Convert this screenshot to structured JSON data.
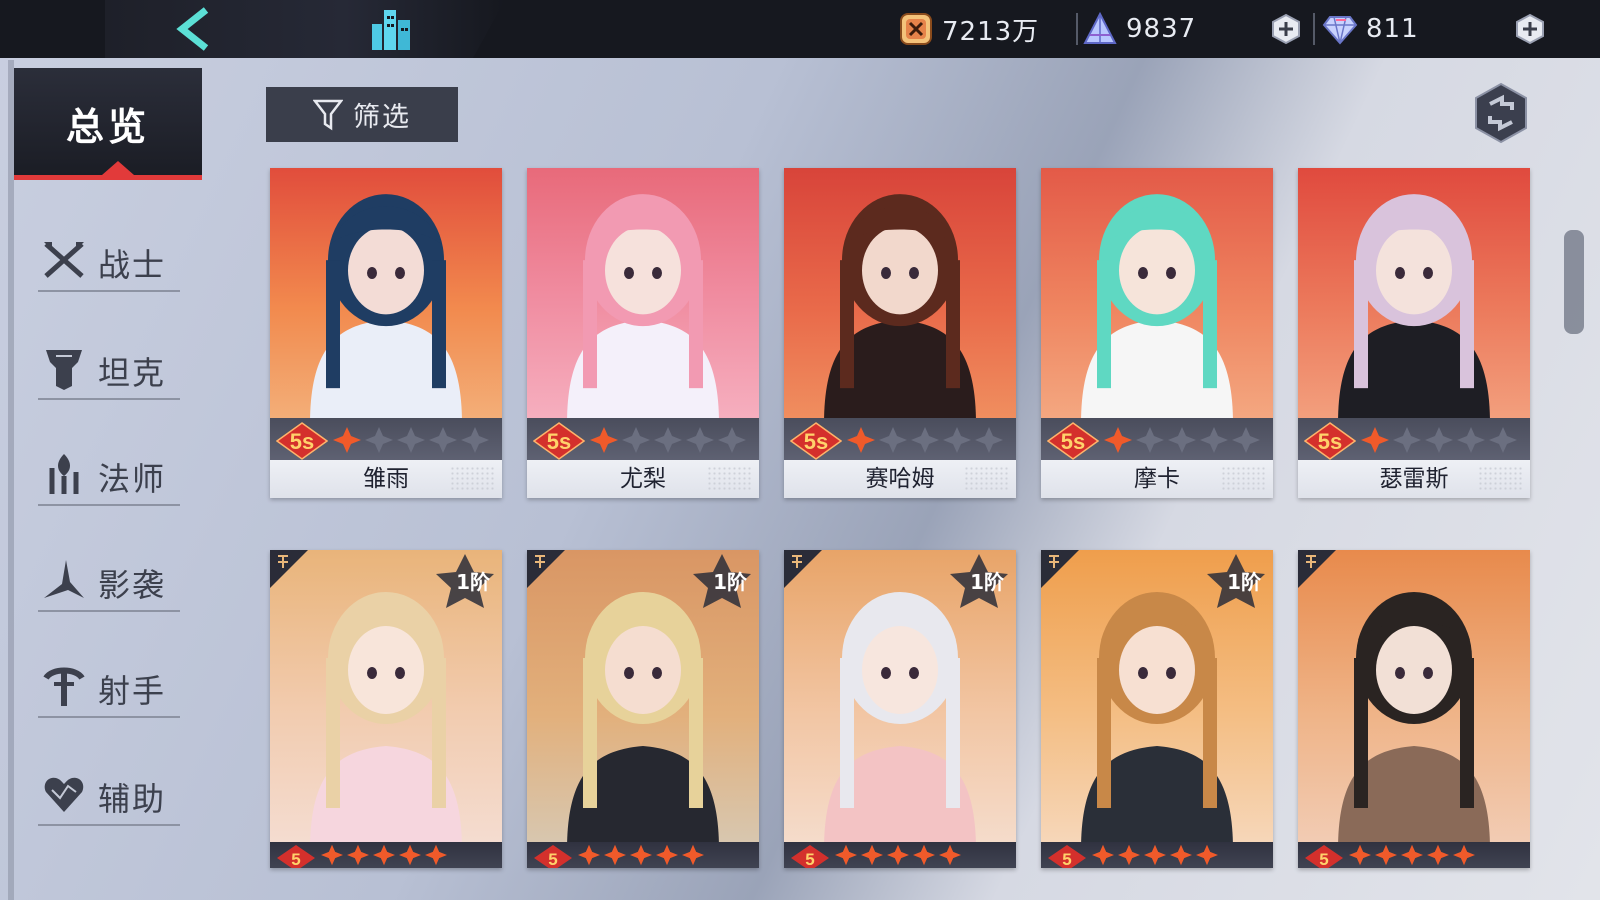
{
  "topbar": {
    "gold": "7213万",
    "crystal": "9837",
    "gem": "811"
  },
  "sidebar": {
    "overview": "总览",
    "roles": [
      {
        "label": "战士",
        "icon": "sword-icon"
      },
      {
        "label": "坦克",
        "icon": "shield-icon"
      },
      {
        "label": "法师",
        "icon": "staff-icon"
      },
      {
        "label": "影袭",
        "icon": "blade-icon"
      },
      {
        "label": "射手",
        "icon": "bow-icon"
      },
      {
        "label": "辅助",
        "icon": "heart-icon"
      }
    ]
  },
  "filter": {
    "label": "筛选"
  },
  "heroes_row1": [
    {
      "name": "雏雨",
      "grade": "5s",
      "stars_lit": 1
    },
    {
      "name": "尤梨",
      "grade": "5s",
      "stars_lit": 1
    },
    {
      "name": "赛哈姆",
      "grade": "5s",
      "stars_lit": 1
    },
    {
      "name": "摩卡",
      "grade": "5s",
      "stars_lit": 1
    },
    {
      "name": "瑟雷斯",
      "grade": "5s",
      "stars_lit": 1
    }
  ],
  "heroes_row2": [
    {
      "rank": "1阶"
    },
    {
      "rank": "1阶"
    },
    {
      "rank": "1阶"
    },
    {
      "rank": "1阶"
    },
    {
      "rank": ""
    }
  ],
  "colors": {
    "accent": "#e23a3a",
    "topbar": "#16181f",
    "star_lit": "#f05a2a",
    "star_dim": "#6b6f80"
  }
}
